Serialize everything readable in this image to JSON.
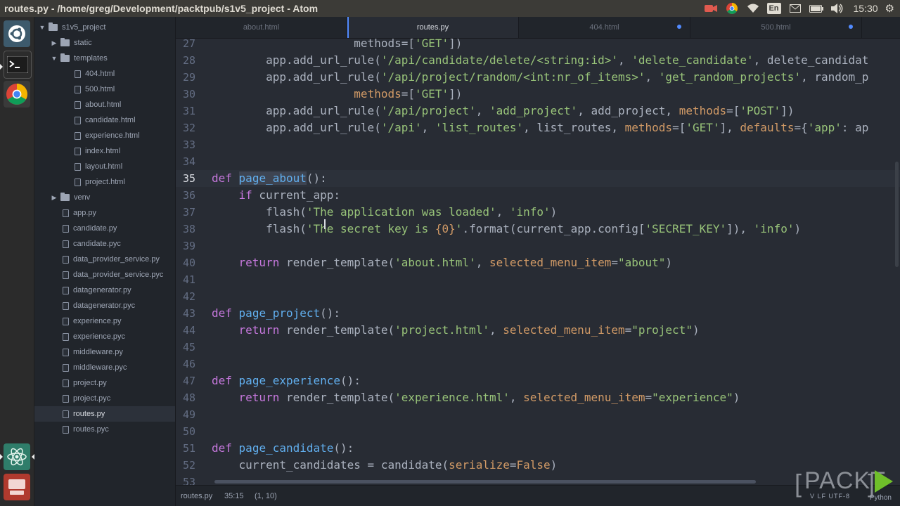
{
  "window": {
    "title": "routes.py - /home/greg/Development/packtpub/s1v5_project - Atom"
  },
  "tray": {
    "language": "En",
    "clock": "15:30"
  },
  "tree": {
    "root": "s1v5_project",
    "items": [
      {
        "label": "static",
        "type": "folder",
        "expanded": false,
        "depth": 1
      },
      {
        "label": "templates",
        "type": "folder",
        "expanded": true,
        "depth": 1
      },
      {
        "label": "404.html",
        "type": "file",
        "depth": 2
      },
      {
        "label": "500.html",
        "type": "file",
        "depth": 2
      },
      {
        "label": "about.html",
        "type": "file",
        "depth": 2
      },
      {
        "label": "candidate.html",
        "type": "file",
        "depth": 2
      },
      {
        "label": "experience.html",
        "type": "file",
        "depth": 2
      },
      {
        "label": "index.html",
        "type": "file",
        "depth": 2
      },
      {
        "label": "layout.html",
        "type": "file",
        "depth": 2
      },
      {
        "label": "project.html",
        "type": "file",
        "depth": 2
      },
      {
        "label": "venv",
        "type": "folder",
        "expanded": false,
        "depth": 1
      },
      {
        "label": "app.py",
        "type": "file",
        "depth": 1
      },
      {
        "label": "candidate.py",
        "type": "file",
        "depth": 1
      },
      {
        "label": "candidate.pyc",
        "type": "file",
        "depth": 1
      },
      {
        "label": "data_provider_service.py",
        "type": "file",
        "depth": 1
      },
      {
        "label": "data_provider_service.pyc",
        "type": "file",
        "depth": 1
      },
      {
        "label": "datagenerator.py",
        "type": "file",
        "depth": 1
      },
      {
        "label": "datagenerator.pyc",
        "type": "file",
        "depth": 1
      },
      {
        "label": "experience.py",
        "type": "file",
        "depth": 1
      },
      {
        "label": "experience.pyc",
        "type": "file",
        "depth": 1
      },
      {
        "label": "middleware.py",
        "type": "file",
        "depth": 1
      },
      {
        "label": "middleware.pyc",
        "type": "file",
        "depth": 1
      },
      {
        "label": "project.py",
        "type": "file",
        "depth": 1
      },
      {
        "label": "project.pyc",
        "type": "file",
        "depth": 1
      },
      {
        "label": "routes.py",
        "type": "file",
        "depth": 1,
        "selected": true
      },
      {
        "label": "routes.pyc",
        "type": "file",
        "depth": 1
      }
    ]
  },
  "tabs": [
    {
      "label": "about.html",
      "active": false,
      "modified": false
    },
    {
      "label": "routes.py",
      "active": true,
      "modified": false
    },
    {
      "label": "404.html",
      "active": false,
      "modified": true
    },
    {
      "label": "500.html",
      "active": false,
      "modified": true
    }
  ],
  "editor": {
    "lines": [
      {
        "n": "27",
        "tokens": [
          [
            "",
            "                     methods=[",
            ""
          ],
          [
            "str",
            "'GET'"
          ],
          [
            "",
            "])"
          ]
        ]
      },
      {
        "n": "28",
        "tokens": [
          [
            "",
            "        app.add_url_rule("
          ],
          [
            "str",
            "'/api/candidate/delete/<string:id>'"
          ],
          [
            "",
            ", "
          ],
          [
            "str",
            "'delete_candidate'"
          ],
          [
            "",
            ", delete_candidat"
          ]
        ]
      },
      {
        "n": "29",
        "tokens": [
          [
            "",
            "        app.add_url_rule("
          ],
          [
            "str",
            "'/api/project/random/<int:nr_of_items>'"
          ],
          [
            "",
            ", "
          ],
          [
            "str",
            "'get_random_projects'"
          ],
          [
            "",
            ", random_p"
          ]
        ]
      },
      {
        "n": "30",
        "tokens": [
          [
            "",
            "                     "
          ],
          [
            "arg",
            "methods"
          ],
          [
            "",
            "=["
          ],
          [
            "str",
            "'GET'"
          ],
          [
            "",
            "])"
          ]
        ]
      },
      {
        "n": "31",
        "tokens": [
          [
            "",
            "        app.add_url_rule("
          ],
          [
            "str",
            "'/api/project'"
          ],
          [
            "",
            ", "
          ],
          [
            "str",
            "'add_project'"
          ],
          [
            "",
            ", add_project, "
          ],
          [
            "arg",
            "methods"
          ],
          [
            "",
            "=["
          ],
          [
            "str",
            "'POST'"
          ],
          [
            "",
            "])"
          ]
        ]
      },
      {
        "n": "32",
        "tokens": [
          [
            "",
            "        app.add_url_rule("
          ],
          [
            "str",
            "'/api'"
          ],
          [
            "",
            ", "
          ],
          [
            "str",
            "'list_routes'"
          ],
          [
            "",
            ", list_routes, "
          ],
          [
            "arg",
            "methods"
          ],
          [
            "",
            "=["
          ],
          [
            "str",
            "'GET'"
          ],
          [
            "",
            "], "
          ],
          [
            "arg",
            "defaults"
          ],
          [
            "",
            "={"
          ],
          [
            "str",
            "'app'"
          ],
          [
            "",
            ": ap"
          ]
        ]
      },
      {
        "n": "33",
        "tokens": []
      },
      {
        "n": "34",
        "tokens": []
      },
      {
        "n": "35",
        "cursor": true,
        "tokens": [
          [
            "kw",
            "def"
          ],
          [
            "",
            " "
          ],
          [
            "fnsel",
            "page_about"
          ],
          [
            "",
            "():"
          ]
        ]
      },
      {
        "n": "36",
        "tokens": [
          [
            "",
            "    "
          ],
          [
            "kw",
            "if"
          ],
          [
            "",
            " current_app:"
          ]
        ]
      },
      {
        "n": "37",
        "tokens": [
          [
            "",
            "        flash("
          ],
          [
            "str",
            "'The application was loaded'"
          ],
          [
            "",
            ", "
          ],
          [
            "str",
            "'info'"
          ],
          [
            "",
            ")"
          ]
        ]
      },
      {
        "n": "38",
        "tokens": [
          [
            "",
            "        flash("
          ],
          [
            "str",
            "'The secret key is "
          ],
          [
            "arg",
            "{0}"
          ],
          [
            "str",
            "'"
          ],
          [
            "",
            ".format(current_app.config["
          ],
          [
            "str",
            "'SECRET_KEY'"
          ],
          [
            "",
            "]), "
          ],
          [
            "str",
            "'info'"
          ],
          [
            "",
            ")"
          ]
        ]
      },
      {
        "n": "39",
        "tokens": []
      },
      {
        "n": "40",
        "tokens": [
          [
            "",
            "    "
          ],
          [
            "kw",
            "return"
          ],
          [
            "",
            " render_template("
          ],
          [
            "str",
            "'about.html'"
          ],
          [
            "",
            ", "
          ],
          [
            "arg",
            "selected_menu_item"
          ],
          [
            "",
            "="
          ],
          [
            "str",
            "\"about\""
          ],
          [
            "",
            ")"
          ]
        ]
      },
      {
        "n": "41",
        "tokens": []
      },
      {
        "n": "42",
        "tokens": []
      },
      {
        "n": "43",
        "tokens": [
          [
            "kw",
            "def"
          ],
          [
            "",
            " "
          ],
          [
            "fn",
            "page_project"
          ],
          [
            "",
            "():"
          ]
        ]
      },
      {
        "n": "44",
        "tokens": [
          [
            "",
            "    "
          ],
          [
            "kw",
            "return"
          ],
          [
            "",
            " render_template("
          ],
          [
            "str",
            "'project.html'"
          ],
          [
            "",
            ", "
          ],
          [
            "arg",
            "selected_menu_item"
          ],
          [
            "",
            "="
          ],
          [
            "str",
            "\"project\""
          ],
          [
            "",
            ")"
          ]
        ]
      },
      {
        "n": "45",
        "tokens": []
      },
      {
        "n": "46",
        "tokens": []
      },
      {
        "n": "47",
        "tokens": [
          [
            "kw",
            "def"
          ],
          [
            "",
            " "
          ],
          [
            "fn",
            "page_experience"
          ],
          [
            "",
            "():"
          ]
        ]
      },
      {
        "n": "48",
        "tokens": [
          [
            "",
            "    "
          ],
          [
            "kw",
            "return"
          ],
          [
            "",
            " render_template("
          ],
          [
            "str",
            "'experience.html'"
          ],
          [
            "",
            ", "
          ],
          [
            "arg",
            "selected_menu_item"
          ],
          [
            "",
            "="
          ],
          [
            "str",
            "\"experience\""
          ],
          [
            "",
            ")"
          ]
        ]
      },
      {
        "n": "49",
        "tokens": []
      },
      {
        "n": "50",
        "tokens": []
      },
      {
        "n": "51",
        "tokens": [
          [
            "kw",
            "def"
          ],
          [
            "",
            " "
          ],
          [
            "fn",
            "page_candidate"
          ],
          [
            "",
            "():"
          ]
        ]
      },
      {
        "n": "52",
        "tokens": [
          [
            "",
            "    current_candidates = candidate("
          ],
          [
            "arg",
            "serialize"
          ],
          [
            "",
            "="
          ],
          [
            "arg",
            "False"
          ],
          [
            "",
            ")"
          ]
        ]
      },
      {
        "n": "53",
        "tokens": []
      }
    ]
  },
  "status": {
    "file": "routes.py",
    "position": "35:15",
    "selection": "(1, 10)"
  },
  "watermark": {
    "brand": "PACKT",
    "sub": "V LF  UTF-8",
    "grammar": "Python"
  }
}
